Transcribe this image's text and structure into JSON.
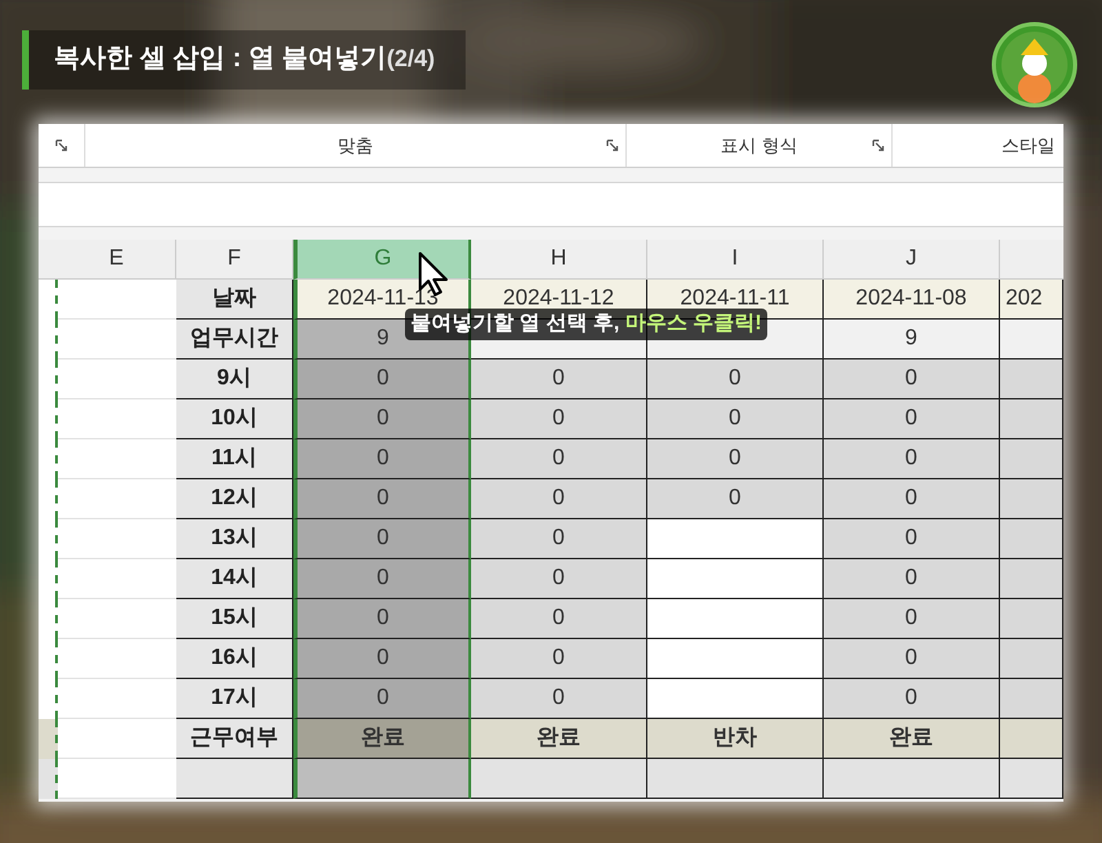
{
  "title": {
    "text": "복사한 셀 삽입 : 열 붙여넣기",
    "counter": "(2/4)"
  },
  "ribbon": {
    "groups": [
      {
        "label": "맞춤"
      },
      {
        "label": "표시 형식"
      },
      {
        "label": "스타일"
      }
    ]
  },
  "columns": [
    {
      "letter": "E",
      "selected": false
    },
    {
      "letter": "F",
      "selected": false
    },
    {
      "letter": "G",
      "selected": true
    },
    {
      "letter": "H",
      "selected": false
    },
    {
      "letter": "I",
      "selected": false
    },
    {
      "letter": "J",
      "selected": false
    }
  ],
  "rows": [
    {
      "label": "날짜",
      "kind": "date",
      "cells": [
        {
          "kind": "value",
          "text": "2024-11-13"
        },
        {
          "kind": "value",
          "text": "2024-11-12"
        },
        {
          "kind": "value",
          "text": "2024-11-11"
        },
        {
          "kind": "value",
          "text": "2024-11-08"
        },
        {
          "kind": "value",
          "text": "202"
        }
      ]
    },
    {
      "label": "업무시간",
      "kind": "hours",
      "cells": [
        {
          "kind": "value",
          "text": "9"
        },
        {
          "kind": "filled"
        },
        {
          "kind": "filled"
        },
        {
          "kind": "value",
          "text": "9"
        },
        {
          "kind": "filled"
        }
      ]
    },
    {
      "label": "9시",
      "kind": "time",
      "cells": [
        {
          "kind": "value",
          "text": "0"
        },
        {
          "kind": "value",
          "text": "0"
        },
        {
          "kind": "value",
          "text": "0"
        },
        {
          "kind": "value",
          "text": "0"
        },
        {
          "kind": "filled"
        }
      ]
    },
    {
      "label": "10시",
      "kind": "time",
      "cells": [
        {
          "kind": "value",
          "text": "0"
        },
        {
          "kind": "value",
          "text": "0"
        },
        {
          "kind": "value",
          "text": "0"
        },
        {
          "kind": "value",
          "text": "0"
        },
        {
          "kind": "filled"
        }
      ]
    },
    {
      "label": "11시",
      "kind": "time",
      "cells": [
        {
          "kind": "value",
          "text": "0"
        },
        {
          "kind": "value",
          "text": "0"
        },
        {
          "kind": "value",
          "text": "0"
        },
        {
          "kind": "value",
          "text": "0"
        },
        {
          "kind": "filled"
        }
      ]
    },
    {
      "label": "12시",
      "kind": "time",
      "cells": [
        {
          "kind": "value",
          "text": "0"
        },
        {
          "kind": "value",
          "text": "0"
        },
        {
          "kind": "value",
          "text": "0"
        },
        {
          "kind": "value",
          "text": "0"
        },
        {
          "kind": "filled"
        }
      ]
    },
    {
      "label": "13시",
      "kind": "time",
      "cells": [
        {
          "kind": "value",
          "text": "0"
        },
        {
          "kind": "value",
          "text": "0"
        },
        {
          "kind": "blank"
        },
        {
          "kind": "value",
          "text": "0"
        },
        {
          "kind": "filled"
        }
      ]
    },
    {
      "label": "14시",
      "kind": "time",
      "cells": [
        {
          "kind": "value",
          "text": "0"
        },
        {
          "kind": "value",
          "text": "0"
        },
        {
          "kind": "blank"
        },
        {
          "kind": "value",
          "text": "0"
        },
        {
          "kind": "filled"
        }
      ]
    },
    {
      "label": "15시",
      "kind": "time",
      "cells": [
        {
          "kind": "value",
          "text": "0"
        },
        {
          "kind": "value",
          "text": "0"
        },
        {
          "kind": "blank"
        },
        {
          "kind": "value",
          "text": "0"
        },
        {
          "kind": "filled"
        }
      ]
    },
    {
      "label": "16시",
      "kind": "time",
      "cells": [
        {
          "kind": "value",
          "text": "0"
        },
        {
          "kind": "value",
          "text": "0"
        },
        {
          "kind": "blank"
        },
        {
          "kind": "value",
          "text": "0"
        },
        {
          "kind": "filled"
        }
      ]
    },
    {
      "label": "17시",
      "kind": "time",
      "cells": [
        {
          "kind": "value",
          "text": "0"
        },
        {
          "kind": "value",
          "text": "0"
        },
        {
          "kind": "blank"
        },
        {
          "kind": "value",
          "text": "0"
        },
        {
          "kind": "filled"
        }
      ]
    },
    {
      "label": "근무여부",
      "kind": "status",
      "cells": [
        {
          "kind": "value",
          "text": "완료"
        },
        {
          "kind": "value",
          "text": "완료"
        },
        {
          "kind": "value",
          "text": "반차"
        },
        {
          "kind": "value",
          "text": "완료"
        },
        {
          "kind": "filled"
        }
      ]
    },
    {
      "kind": "extra",
      "cells": [
        {
          "kind": "filled"
        },
        {
          "kind": "filled"
        },
        {
          "kind": "filled"
        },
        {
          "kind": "filled"
        },
        {
          "kind": "filled"
        }
      ]
    }
  ],
  "caption": {
    "text": "붙여넣기할 열 선택 후, ",
    "highlight": "마우스 우클릭!"
  }
}
